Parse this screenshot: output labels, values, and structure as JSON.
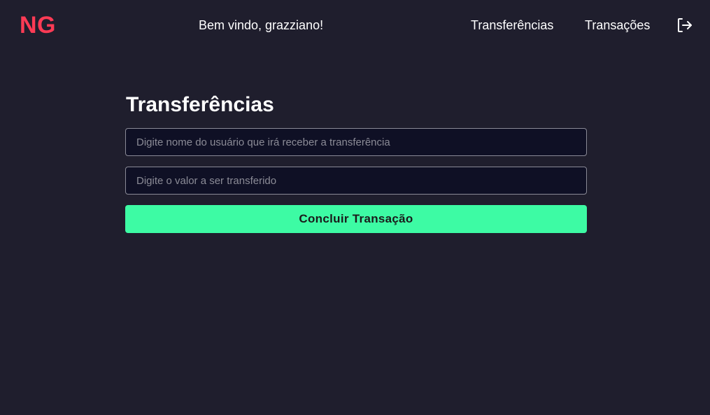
{
  "header": {
    "logo": "NG",
    "welcome": "Bem vindo, grazziano!",
    "nav": {
      "transfers": "Transferências",
      "transactions": "Transações"
    },
    "logout_icon": "logout-icon"
  },
  "main": {
    "title": "Transferências",
    "recipient_placeholder": "Digite nome do usuário que irá receber a transferência",
    "recipient_value": "",
    "amount_placeholder": "Digite o valor a ser transferido",
    "amount_value": "",
    "submit_label": "Concluir Transação"
  },
  "colors": {
    "background": "#1f1e2d",
    "logo": "#ff3b55",
    "input_background": "#0f1025",
    "button": "#3dfba4"
  }
}
